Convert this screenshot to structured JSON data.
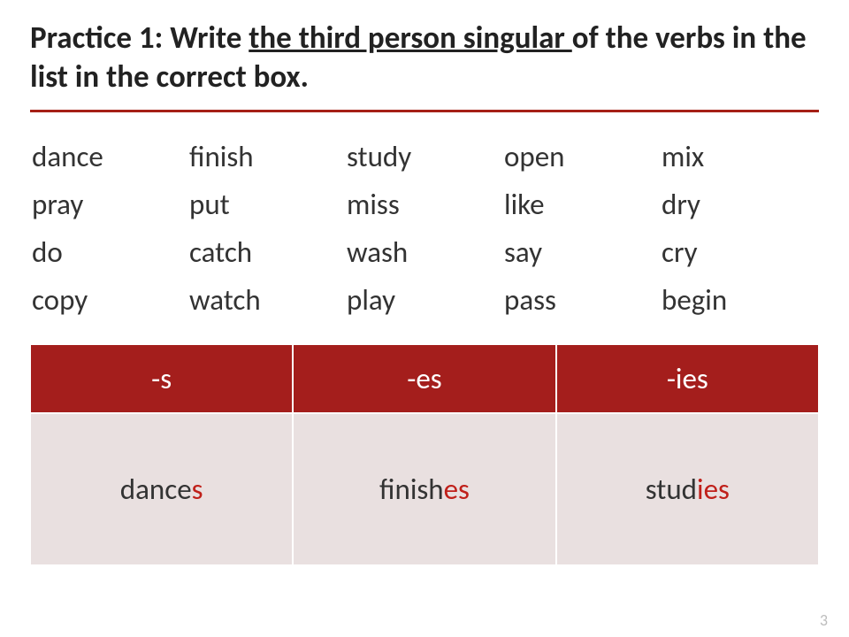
{
  "title": {
    "prefix": "Practice 1: Write ",
    "underlined": "the third person singular ",
    "suffix": "of the verbs in the list in the correct box."
  },
  "verbs": [
    [
      "dance",
      "finish",
      "study",
      "open",
      "mix"
    ],
    [
      "pray",
      "put",
      "miss",
      "like",
      "dry"
    ],
    [
      "do",
      "catch",
      "wash",
      "say",
      "cry"
    ],
    [
      "copy",
      "watch",
      "play",
      "pass",
      "begin"
    ]
  ],
  "table": {
    "headers": [
      "-s",
      "-es",
      "-ies"
    ],
    "row": [
      {
        "stem": "dance",
        "suffix": "s"
      },
      {
        "stem": "finish",
        "suffix": "es"
      },
      {
        "stem": "stud",
        "suffix": "ies"
      }
    ]
  },
  "page_number": "3"
}
